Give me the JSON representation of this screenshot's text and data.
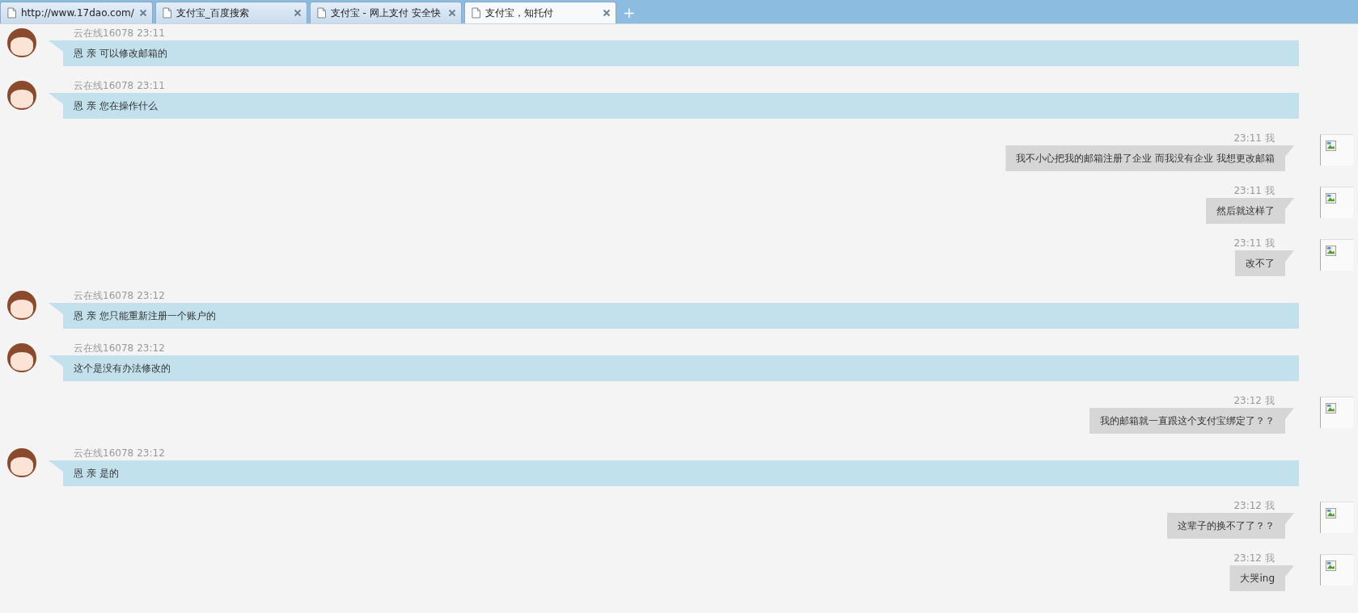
{
  "tabs": [
    {
      "title": "http://www.17dao.com/",
      "selected": false
    },
    {
      "title": "支付宝_百度搜索",
      "selected": false
    },
    {
      "title": "支付宝 - 网上支付 安全快",
      "selected": false
    },
    {
      "title": "支付宝，知托付",
      "selected": true
    }
  ],
  "new_tab": "+",
  "messages": [
    {
      "kind": "agent",
      "sender": "云在线16078",
      "time": "23:11",
      "text": "恩 亲 可以修改邮箱的"
    },
    {
      "kind": "agent",
      "sender": "云在线16078",
      "time": "23:11",
      "text": "恩 亲 您在操作什么"
    },
    {
      "kind": "me",
      "sender": "我",
      "time": "23:11",
      "text": "我不小心把我的邮箱注册了企业 而我没有企业 我想更改邮箱"
    },
    {
      "kind": "me",
      "sender": "我",
      "time": "23:11",
      "text": "然后就这样了"
    },
    {
      "kind": "me",
      "sender": "我",
      "time": "23:11",
      "text": "改不了"
    },
    {
      "kind": "agent",
      "sender": "云在线16078",
      "time": "23:12",
      "text": "恩 亲 您只能重新注册一个账户的"
    },
    {
      "kind": "agent",
      "sender": "云在线16078",
      "time": "23:12",
      "text": "这个是没有办法修改的"
    },
    {
      "kind": "me",
      "sender": "我",
      "time": "23:12",
      "text": "我的邮箱就一直跟这个支付宝绑定了？？"
    },
    {
      "kind": "agent",
      "sender": "云在线16078",
      "time": "23:12",
      "text": "恩 亲 是的"
    },
    {
      "kind": "me",
      "sender": "我",
      "time": "23:12",
      "text": "这辈子的换不了了？？"
    },
    {
      "kind": "me",
      "sender": "我",
      "time": "23:12",
      "text": "大哭ing"
    }
  ]
}
